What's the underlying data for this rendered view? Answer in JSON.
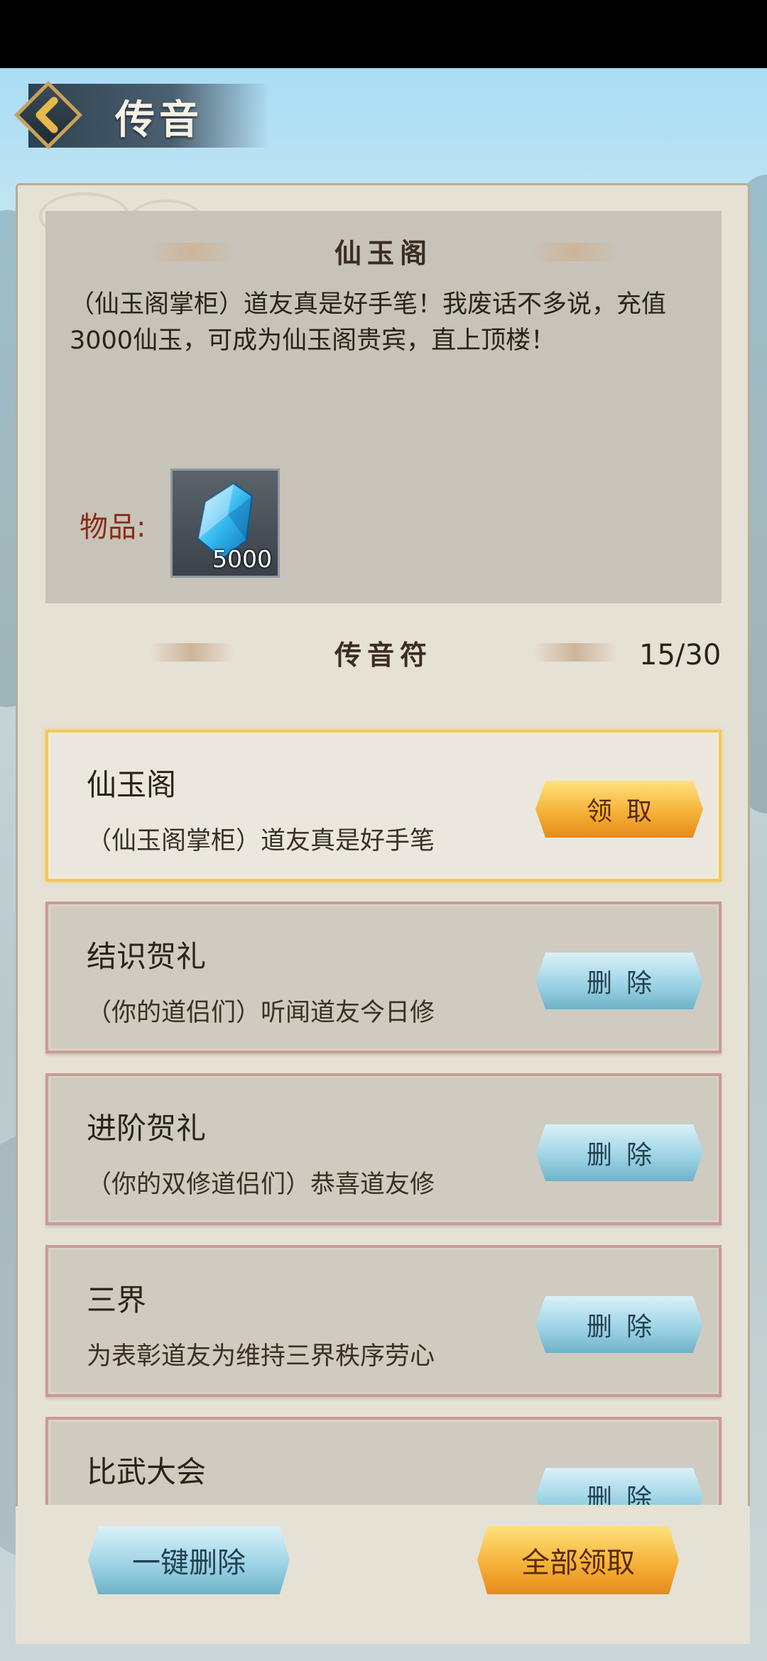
{
  "header": {
    "title": "传音",
    "back_icon": "chevron-left-icon"
  },
  "detail": {
    "section_title": "仙玉阁",
    "body": "（仙玉阁掌柜）道友真是好手笔！我废话不多说，充值3000仙玉，可成为仙玉阁贵宾，直上顶楼！",
    "items_label": "物品:",
    "item": {
      "icon": "blue-jade-crystal-icon",
      "quantity": "5000"
    }
  },
  "list": {
    "section_title": "传音符",
    "count": "15/30",
    "mails": [
      {
        "title": "仙玉阁",
        "preview": "（仙玉阁掌柜）道友真是好手笔",
        "button": "领取",
        "active": true
      },
      {
        "title": "结识贺礼",
        "preview": "（你的道侣们）听闻道友今日修",
        "button": "删除",
        "active": false
      },
      {
        "title": "进阶贺礼",
        "preview": "（你的双修道侣们）恭喜道友修",
        "button": "删除",
        "active": false
      },
      {
        "title": "三界",
        "preview": "为表彰道友为维持三界秩序劳心",
        "button": "删除",
        "active": false
      },
      {
        "title": "比武大会",
        "preview": "",
        "button": "删除",
        "active": false
      }
    ]
  },
  "footer": {
    "delete_all": "一键删除",
    "claim_all": "全部领取"
  },
  "colors": {
    "gold_button": "#f6b23a",
    "blue_button": "#9ed4e6",
    "active_border": "#f2c85a",
    "item_border": "#c99a98"
  }
}
